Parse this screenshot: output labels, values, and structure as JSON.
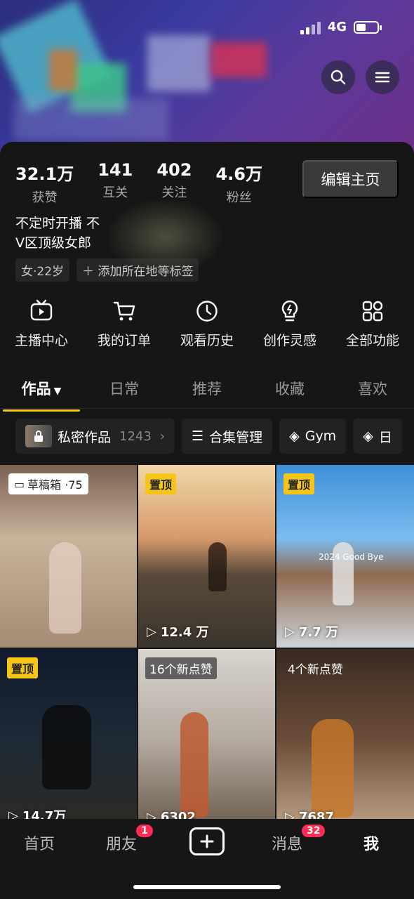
{
  "status_bar": {
    "network": "4G"
  },
  "stats": [
    {
      "value": "32.1万",
      "label": "获赞"
    },
    {
      "value": "141",
      "label": "互关"
    },
    {
      "value": "402",
      "label": "关注"
    },
    {
      "value": "4.6万",
      "label": "粉丝"
    }
  ],
  "edit_button": "编辑主页",
  "bio": {
    "line1": "不定时开播 不",
    "line2": "V区顶级女郎"
  },
  "tags": {
    "gender_age": "女·22岁",
    "add": "＋ 添加所在地等标签"
  },
  "features": [
    {
      "label": "主播中心",
      "icon": "tv-icon"
    },
    {
      "label": "我的订单",
      "icon": "cart-icon"
    },
    {
      "label": "观看历史",
      "icon": "clock-icon"
    },
    {
      "label": "创作灵感",
      "icon": "bulb-icon"
    },
    {
      "label": "全部功能",
      "icon": "grid-icon"
    }
  ],
  "tabs": [
    "作品",
    "日常",
    "推荐",
    "收藏",
    "喜欢"
  ],
  "filters": {
    "private": {
      "label": "私密作品",
      "count": "1243"
    },
    "collection": "合集管理",
    "gym": "Gym",
    "partial": "日"
  },
  "grid": [
    {
      "badge": "草稿箱 ·75",
      "badge_type": "draft",
      "plays": ""
    },
    {
      "badge": "置顶",
      "badge_type": "pinned",
      "plays": "12.4 万"
    },
    {
      "badge": "置顶",
      "badge_type": "pinned",
      "plays": "7.7 万",
      "overlay": "2024 Good Bye"
    },
    {
      "badge": "置顶",
      "badge_type": "pinned",
      "plays": "14.7万"
    },
    {
      "badge": "16个新点赞",
      "badge_type": "likes",
      "plays": "6302"
    },
    {
      "badge": "4个新点赞",
      "badge_type": "likes",
      "plays": "7687"
    }
  ],
  "bottom_nav": {
    "home": "首页",
    "friends": "朋友",
    "friends_badge": "1",
    "messages": "消息",
    "messages_badge": "32",
    "me": "我"
  }
}
